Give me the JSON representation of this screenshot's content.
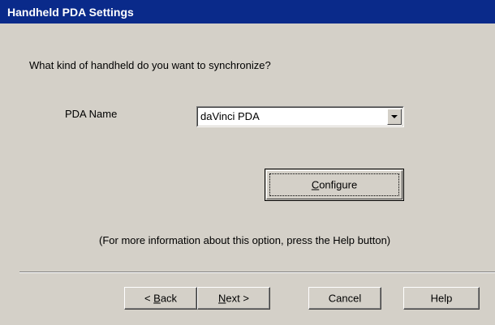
{
  "window": {
    "title": "Handheld PDA Settings"
  },
  "main": {
    "question": "What kind of handheld do you want to synchronize?",
    "pda_label": "PDA Name",
    "pda_selected": "daVinci PDA",
    "configure": {
      "mnemonic": "C",
      "rest": "onfigure"
    },
    "info": "(For more information about this option, press the Help button)"
  },
  "footer": {
    "back": {
      "prefix": "< ",
      "mnemonic": "B",
      "rest": "ack"
    },
    "next": {
      "mnemonic": "N",
      "rest": "ext >"
    },
    "cancel": "Cancel",
    "help": "Help"
  },
  "colors": {
    "titlebar": "#0a2a8a",
    "dialog": "#d4d0c8"
  },
  "icons": {
    "dropdown": "chevron-down-icon"
  }
}
